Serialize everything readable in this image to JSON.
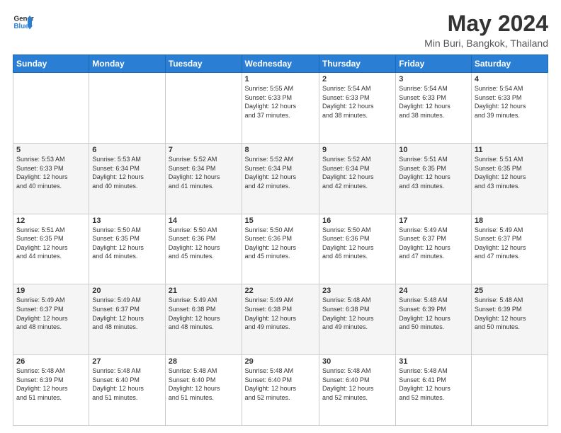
{
  "logo": {
    "line1": "General",
    "line2": "Blue"
  },
  "title": "May 2024",
  "subtitle": "Min Buri, Bangkok, Thailand",
  "headers": [
    "Sunday",
    "Monday",
    "Tuesday",
    "Wednesday",
    "Thursday",
    "Friday",
    "Saturday"
  ],
  "weeks": [
    [
      {
        "day": "",
        "info": ""
      },
      {
        "day": "",
        "info": ""
      },
      {
        "day": "",
        "info": ""
      },
      {
        "day": "1",
        "info": "Sunrise: 5:55 AM\nSunset: 6:33 PM\nDaylight: 12 hours\nand 37 minutes."
      },
      {
        "day": "2",
        "info": "Sunrise: 5:54 AM\nSunset: 6:33 PM\nDaylight: 12 hours\nand 38 minutes."
      },
      {
        "day": "3",
        "info": "Sunrise: 5:54 AM\nSunset: 6:33 PM\nDaylight: 12 hours\nand 38 minutes."
      },
      {
        "day": "4",
        "info": "Sunrise: 5:54 AM\nSunset: 6:33 PM\nDaylight: 12 hours\nand 39 minutes."
      }
    ],
    [
      {
        "day": "5",
        "info": "Sunrise: 5:53 AM\nSunset: 6:33 PM\nDaylight: 12 hours\nand 40 minutes."
      },
      {
        "day": "6",
        "info": "Sunrise: 5:53 AM\nSunset: 6:34 PM\nDaylight: 12 hours\nand 40 minutes."
      },
      {
        "day": "7",
        "info": "Sunrise: 5:52 AM\nSunset: 6:34 PM\nDaylight: 12 hours\nand 41 minutes."
      },
      {
        "day": "8",
        "info": "Sunrise: 5:52 AM\nSunset: 6:34 PM\nDaylight: 12 hours\nand 42 minutes."
      },
      {
        "day": "9",
        "info": "Sunrise: 5:52 AM\nSunset: 6:34 PM\nDaylight: 12 hours\nand 42 minutes."
      },
      {
        "day": "10",
        "info": "Sunrise: 5:51 AM\nSunset: 6:35 PM\nDaylight: 12 hours\nand 43 minutes."
      },
      {
        "day": "11",
        "info": "Sunrise: 5:51 AM\nSunset: 6:35 PM\nDaylight: 12 hours\nand 43 minutes."
      }
    ],
    [
      {
        "day": "12",
        "info": "Sunrise: 5:51 AM\nSunset: 6:35 PM\nDaylight: 12 hours\nand 44 minutes."
      },
      {
        "day": "13",
        "info": "Sunrise: 5:50 AM\nSunset: 6:35 PM\nDaylight: 12 hours\nand 44 minutes."
      },
      {
        "day": "14",
        "info": "Sunrise: 5:50 AM\nSunset: 6:36 PM\nDaylight: 12 hours\nand 45 minutes."
      },
      {
        "day": "15",
        "info": "Sunrise: 5:50 AM\nSunset: 6:36 PM\nDaylight: 12 hours\nand 45 minutes."
      },
      {
        "day": "16",
        "info": "Sunrise: 5:50 AM\nSunset: 6:36 PM\nDaylight: 12 hours\nand 46 minutes."
      },
      {
        "day": "17",
        "info": "Sunrise: 5:49 AM\nSunset: 6:37 PM\nDaylight: 12 hours\nand 47 minutes."
      },
      {
        "day": "18",
        "info": "Sunrise: 5:49 AM\nSunset: 6:37 PM\nDaylight: 12 hours\nand 47 minutes."
      }
    ],
    [
      {
        "day": "19",
        "info": "Sunrise: 5:49 AM\nSunset: 6:37 PM\nDaylight: 12 hours\nand 48 minutes."
      },
      {
        "day": "20",
        "info": "Sunrise: 5:49 AM\nSunset: 6:37 PM\nDaylight: 12 hours\nand 48 minutes."
      },
      {
        "day": "21",
        "info": "Sunrise: 5:49 AM\nSunset: 6:38 PM\nDaylight: 12 hours\nand 48 minutes."
      },
      {
        "day": "22",
        "info": "Sunrise: 5:49 AM\nSunset: 6:38 PM\nDaylight: 12 hours\nand 49 minutes."
      },
      {
        "day": "23",
        "info": "Sunrise: 5:48 AM\nSunset: 6:38 PM\nDaylight: 12 hours\nand 49 minutes."
      },
      {
        "day": "24",
        "info": "Sunrise: 5:48 AM\nSunset: 6:39 PM\nDaylight: 12 hours\nand 50 minutes."
      },
      {
        "day": "25",
        "info": "Sunrise: 5:48 AM\nSunset: 6:39 PM\nDaylight: 12 hours\nand 50 minutes."
      }
    ],
    [
      {
        "day": "26",
        "info": "Sunrise: 5:48 AM\nSunset: 6:39 PM\nDaylight: 12 hours\nand 51 minutes."
      },
      {
        "day": "27",
        "info": "Sunrise: 5:48 AM\nSunset: 6:40 PM\nDaylight: 12 hours\nand 51 minutes."
      },
      {
        "day": "28",
        "info": "Sunrise: 5:48 AM\nSunset: 6:40 PM\nDaylight: 12 hours\nand 51 minutes."
      },
      {
        "day": "29",
        "info": "Sunrise: 5:48 AM\nSunset: 6:40 PM\nDaylight: 12 hours\nand 52 minutes."
      },
      {
        "day": "30",
        "info": "Sunrise: 5:48 AM\nSunset: 6:40 PM\nDaylight: 12 hours\nand 52 minutes."
      },
      {
        "day": "31",
        "info": "Sunrise: 5:48 AM\nSunset: 6:41 PM\nDaylight: 12 hours\nand 52 minutes."
      },
      {
        "day": "",
        "info": ""
      }
    ]
  ],
  "accent_color": "#2a7fd4"
}
